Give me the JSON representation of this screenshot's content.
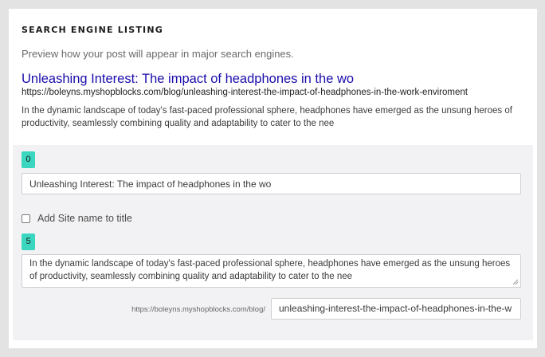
{
  "section": {
    "title": "SEARCH ENGINE LISTING",
    "description": "Preview how your post will appear in major search engines."
  },
  "preview": {
    "title": "Unleashing Interest: The impact of headphones in the wo",
    "url": "https://boleyns.myshopblocks.com/blog/unleashing-interest-the-impact-of-headphones-in-the-work-enviroment",
    "description": "In the dynamic landscape of today's fast-paced professional sphere, headphones have emerged as the unsung heroes of productivity, seamlessly combining quality and adaptability to cater to the nee"
  },
  "form": {
    "title_counter": "0",
    "title_value": "Unleashing Interest: The impact of headphones in the wo",
    "add_site_name_label": "Add Site name to title",
    "add_site_name_checked": false,
    "description_counter": "5",
    "description_value": "In the dynamic landscape of today's fast-paced professional sphere, headphones have emerged as the unsung heroes of productivity, seamlessly combining quality and adaptability to cater to the nee",
    "slug_prefix": "https://boleyns.myshopblocks.com/blog/",
    "slug_value": "unleashing-interest-the-impact-of-headphones-in-the-w"
  },
  "colors": {
    "counter_bg": "#3ad6bf",
    "preview_title": "#1a0dab",
    "form_bg": "#f2f2f4"
  }
}
